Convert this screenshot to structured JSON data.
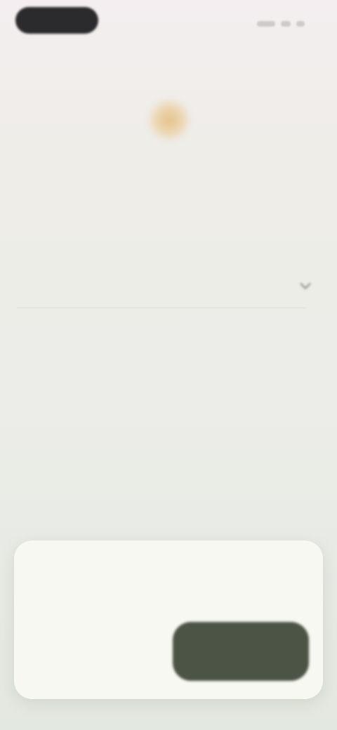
{
  "status_bar": {
    "time": "",
    "icons": [
      "signal-icon",
      "wifi-icon",
      "battery-icon"
    ]
  },
  "app": {
    "icon": "brand-icon",
    "title": ""
  },
  "setting": {
    "title": "",
    "subtitle": "",
    "icon": "chevron-down-icon"
  },
  "dialog": {
    "title": "",
    "message": "",
    "cancel_label": "",
    "confirm_label": ""
  },
  "colors": {
    "accent": "#4c5545",
    "dialog_background": "#f8f8f2",
    "brand_icon": "#e6c38a",
    "page_background": "#eeede7"
  }
}
